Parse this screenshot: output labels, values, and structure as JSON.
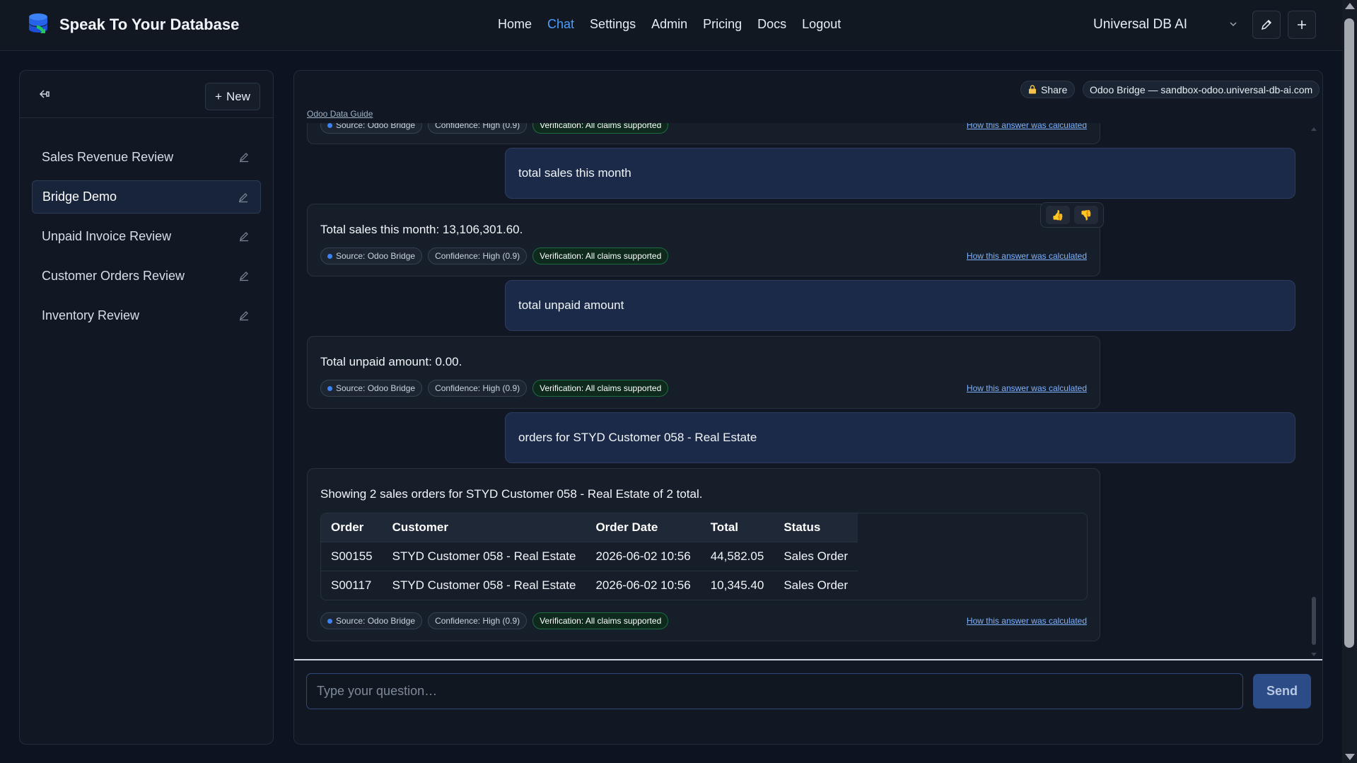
{
  "brand": {
    "name": "Speak To Your Database"
  },
  "nav": {
    "items": [
      {
        "label": "Home",
        "active": false
      },
      {
        "label": "Chat",
        "active": true
      },
      {
        "label": "Settings",
        "active": false
      },
      {
        "label": "Admin",
        "active": false
      },
      {
        "label": "Pricing",
        "active": false
      },
      {
        "label": "Docs",
        "active": false
      },
      {
        "label": "Logout",
        "active": false
      }
    ],
    "database": "Universal DB AI"
  },
  "sidebar": {
    "new_label": "New",
    "conversations": [
      {
        "label": "Sales Revenue Review",
        "active": false
      },
      {
        "label": "Bridge Demo",
        "active": true
      },
      {
        "label": "Unpaid Invoice Review",
        "active": false
      },
      {
        "label": "Customer Orders Review",
        "active": false
      },
      {
        "label": "Inventory Review",
        "active": false
      }
    ]
  },
  "main": {
    "share_label": "Share",
    "source_pill": "Odoo Bridge — sandbox-odoo.universal-db-ai.com",
    "guide_link": "Odoo Data Guide",
    "messages": {
      "partial_badges": [
        "Source: Odoo Bridge",
        "Confidence: High (0.9)",
        "Verification: All claims supported"
      ],
      "user1": "total sales this month",
      "bot1": "Total sales this month: 13,106,301.60.",
      "user2": "total unpaid amount",
      "bot2": "Total unpaid amount: 0.00.",
      "user3": "orders for STYD Customer 058 - Real Estate",
      "bot3": "Showing 2 sales orders for STYD Customer 058 - Real Estate of 2 total."
    },
    "badges": {
      "source": "Source: Odoo Bridge",
      "confidence": "Confidence: High (0.9)",
      "verification": "Verification: All claims supported",
      "calc_link": "How this answer was calculated"
    },
    "table": {
      "headers": [
        "Order",
        "Customer",
        "Order Date",
        "Total",
        "Status"
      ],
      "rows": [
        [
          "S00155",
          "STYD Customer 058 - Real Estate",
          "2026-06-02 10:56",
          "44,582.05",
          "Sales Order"
        ],
        [
          "S00117",
          "STYD Customer 058 - Real Estate",
          "2026-06-02 10:56",
          "10,345.40",
          "Sales Order"
        ]
      ]
    },
    "input": {
      "placeholder": "Type your question…",
      "send_label": "Send"
    }
  },
  "colors": {
    "accent": "#4b9dff",
    "verify_bg": "#0d2a1d",
    "user_bubble": "#1b2a48"
  }
}
